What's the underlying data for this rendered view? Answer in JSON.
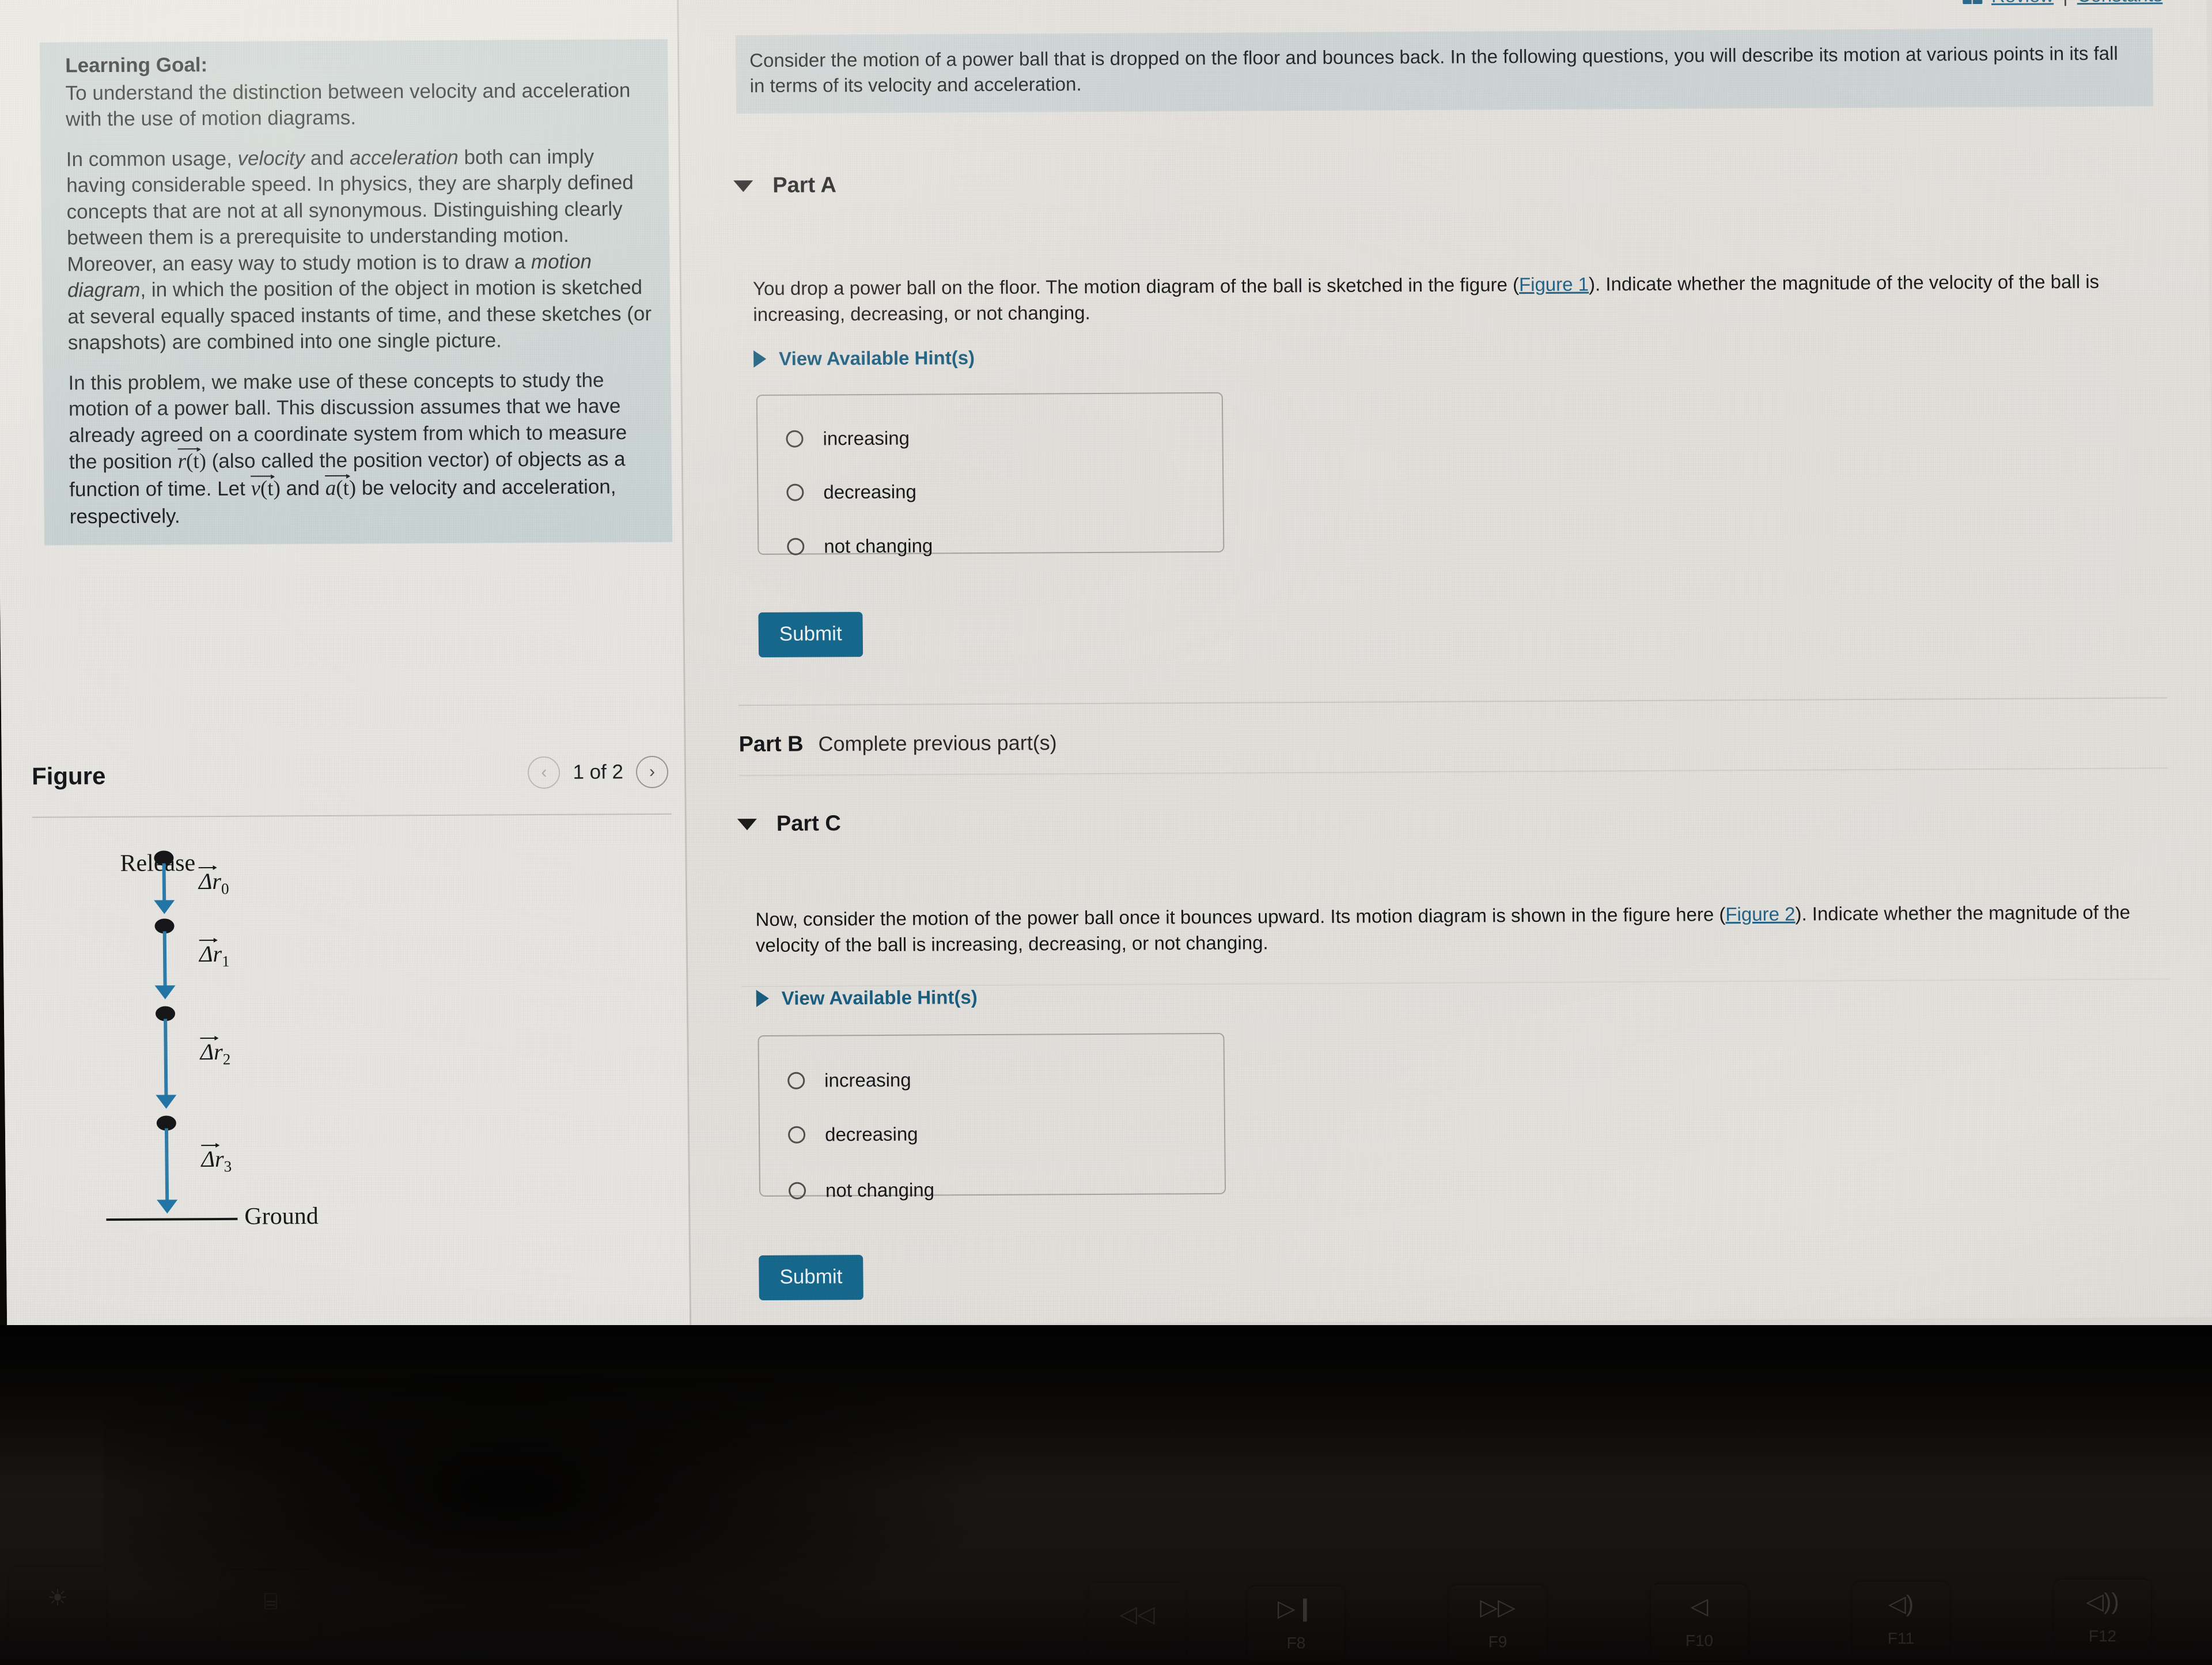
{
  "topbar": {
    "book_icon": "book-icon",
    "review_link": "Review",
    "separator": "|",
    "constants_link": "Constants"
  },
  "sidebar": {
    "learning_goal_title": "Learning Goal:",
    "learning_goal_text": "To understand the distinction between velocity and acceleration with the use of motion diagrams.",
    "paragraph_2_a": "In common usage, ",
    "paragraph_2_italic_1": "velocity",
    "paragraph_2_b": " and ",
    "paragraph_2_italic_2": "acceleration",
    "paragraph_2_c": " both can imply having considerable speed. In physics, they are sharply defined concepts that are not at all synonymous. Distinguishing clearly between them is a prerequisite to understanding motion. Moreover, an easy way to study motion is to draw a ",
    "paragraph_2_italic_3": "motion diagram",
    "paragraph_2_d": ", in which the position of the object in motion is sketched at several equally spaced instants of time, and these sketches (or snapshots) are combined into one single picture.",
    "paragraph_3_a": "In this problem, we make use of these concepts to study the motion of a power ball. This discussion assumes that we have already agreed on a coordinate system from which to measure the position ",
    "paragraph_3_math_r": "r",
    "paragraph_3_b": " (also called the position vector) of objects as a function of time. Let ",
    "paragraph_3_math_v": "v",
    "paragraph_3_c": " and ",
    "paragraph_3_math_a": "a",
    "paragraph_3_d": " be velocity and acceleration, respectively.",
    "math_arg": "(t)"
  },
  "figure": {
    "title": "Figure",
    "prev_icon": "chevron-left-icon",
    "next_icon": "chevron-right-icon",
    "counter": "1 of 2",
    "release_label": "Release",
    "ground_label": "Ground",
    "vector_labels": [
      "Δr",
      "Δr",
      "Δr",
      "Δr"
    ],
    "vector_subscripts": [
      "0",
      "1",
      "2",
      "3"
    ]
  },
  "main": {
    "intro": "Consider the motion of a power ball that is dropped on the floor and bounces back. In the following questions, you will describe its motion at various points in its fall in terms of its velocity and acceleration.",
    "part_a": {
      "caret_icon": "caret-down-icon",
      "label": "Part A",
      "question_a": "You drop a power ball on the floor. The motion diagram of the ball is sketched in the figure (",
      "figure_link": "Figure 1",
      "question_b": "). Indicate whether the magnitude of the velocity of the ball is increasing, decreasing, or not changing.",
      "hint_icon": "caret-right-icon",
      "hint_label": "View Available Hint(s)",
      "options": [
        "increasing",
        "decreasing",
        "not changing"
      ],
      "submit_label": "Submit"
    },
    "part_b": {
      "label": "Part B",
      "status": "Complete previous part(s)"
    },
    "part_c": {
      "caret_icon": "caret-down-icon",
      "label": "Part C",
      "question_a": "Now, consider the motion of the power ball once it bounces upward. Its motion diagram is shown in the figure here (",
      "figure_link": "Figure 2",
      "question_b": "). Indicate whether the magnitude of the velocity of the ball is increasing, decreasing, or not changing.",
      "hint_icon": "caret-right-icon",
      "hint_label": "View Available Hint(s)",
      "options": [
        "increasing",
        "decreasing",
        "not changing"
      ],
      "submit_label": "Submit"
    },
    "cursor_icon": "mouse-pointer-icon"
  },
  "keyboard": {
    "keys": [
      {
        "glyph": "▷❙",
        "name": "F8",
        "icon": "play-pause-icon"
      },
      {
        "glyph": "▷▷",
        "name": "F9",
        "icon": "fast-forward-icon"
      },
      {
        "glyph": "◁",
        "name": "F10",
        "icon": "mute-icon"
      },
      {
        "glyph": "◁)",
        "name": "F11",
        "icon": "volume-down-icon"
      },
      {
        "glyph": "◁))",
        "name": "F12",
        "icon": "volume-up-icon"
      }
    ],
    "left_keys": [
      {
        "glyph": "☀",
        "name": "",
        "icon": "brightness-icon"
      },
      {
        "glyph": "⌸",
        "name": "",
        "icon": "mission-control-icon"
      },
      {
        "glyph": "◁◁",
        "name": "",
        "icon": "rewind-icon"
      }
    ]
  },
  "colors": {
    "accent_link": "#1f6286",
    "submit_bg": "#176a90",
    "banner_bg": "#cfd6d7",
    "learning_bg": "#ccd6d6",
    "page_bg": "#e7e4e0",
    "vector_blue": "#2e7fae"
  }
}
